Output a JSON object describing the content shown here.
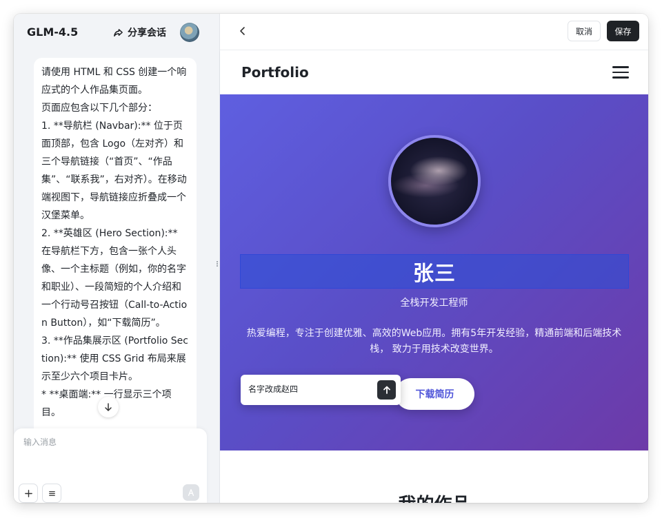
{
  "left_panel": {
    "model_name": "GLM-4.5",
    "share_label": "分享会话",
    "message_lines": [
      "请使用 HTML 和 CSS 创建一个响应式的个人作品集页面。",
      "页面应包含以下几个部分：",
      "1. **导航栏 (Navbar):** 位于页面顶部，包含 Logo（左对齐）和三个导航链接（“首页”、“作品集”、“联系我”，右对齐）。在移动端视图下，导航链接应折叠成一个汉堡菜单。",
      "2. **英雄区 (Hero Section):** 在导航栏下方，包含一张个人头像、一个主标题（例如，你的名字和职业）、一段简短的个人介绍和一个行动号召按钮（Call-to-Action Button），如“下载简历”。",
      "3. **作品集展示区 (Portfolio Section):** 使用 CSS Grid 布局来展示至少六个项目卡片。",
      "* **桌面端:** 一行显示三个项目。"
    ],
    "composer_placeholder": "输入消息"
  },
  "toolbar": {
    "cancel_label": "取消",
    "save_label": "保存"
  },
  "site": {
    "logo": "Portfolio",
    "hero": {
      "name": "张三",
      "role": "全栈开发工程师",
      "bio": "热爱编程，专注于创建优雅、高效的Web应用。拥有5年开发经验，精通前端和后端技术栈， 致力于用技术改变世界。",
      "cta_label": "下载简历"
    },
    "portfolio_title": "我的作品"
  },
  "edit_popover": {
    "value": "名字改成赵四"
  },
  "icons": {
    "share": "share-arrow-icon",
    "back": "chevron-left-icon",
    "menu": "hamburger-menu-icon",
    "send": "arrow-up-icon",
    "scroll": "arrow-down-icon",
    "add": "plus-icon",
    "list": "list-icon"
  },
  "colors": {
    "hero_gradient_start": "#5f5fe0",
    "hero_gradient_end": "#6d3aa8",
    "selection_outline": "#2f47d6",
    "save_button": "#1f2226",
    "cta_text": "#4f55d9"
  }
}
